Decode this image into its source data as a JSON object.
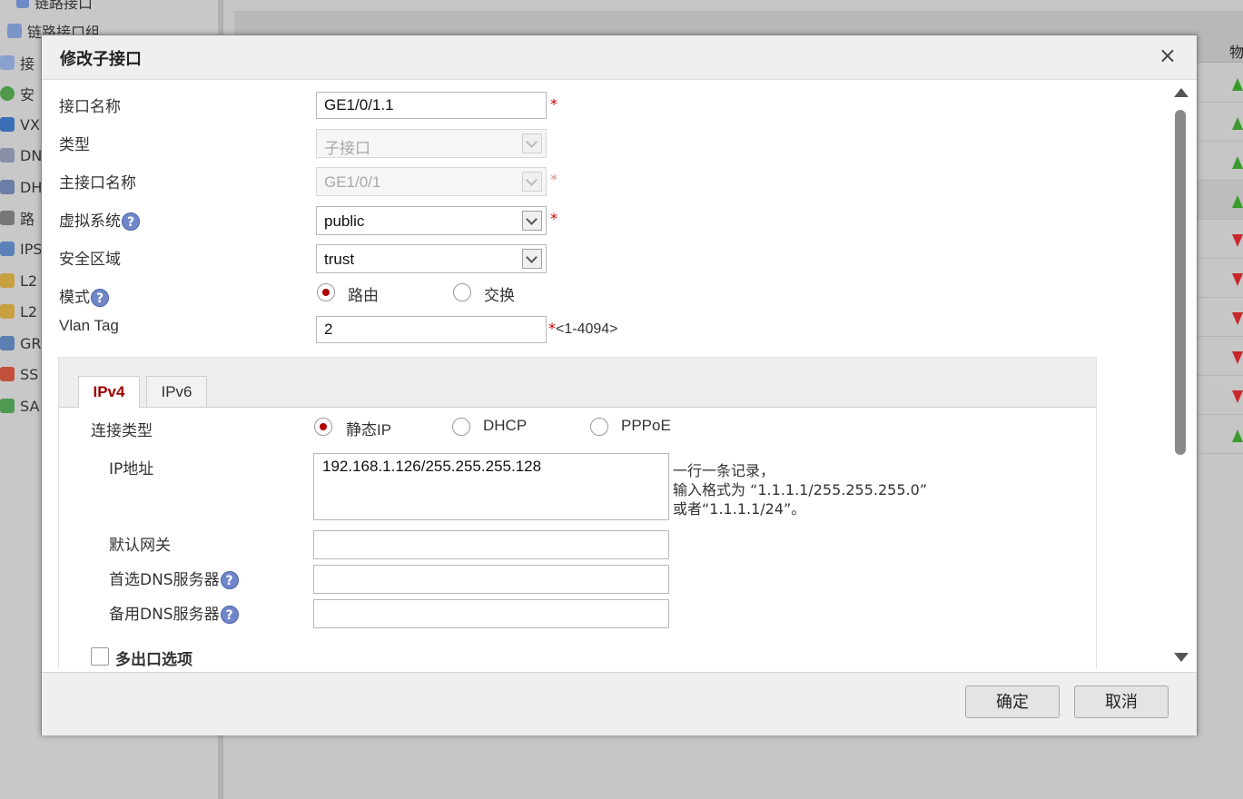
{
  "background": {
    "sidebar_items": [
      "链路接口",
      "链路接口组",
      "接",
      "安",
      "VX",
      "DN",
      "DH",
      "路",
      "IPS",
      "L2",
      "L2",
      "GR",
      "SS",
      "SA"
    ],
    "table_header_first": "物"
  },
  "dialog": {
    "title": "修改子接口",
    "close_icon": "×",
    "fields": {
      "interface_name": {
        "label": "接口名称",
        "value": "GE1/0/1.1"
      },
      "type": {
        "label": "类型",
        "value": "子接口"
      },
      "main_interface": {
        "label": "主接口名称",
        "value": "GE1/0/1"
      },
      "virtual_system": {
        "label": "虚拟系统",
        "value": "public"
      },
      "security_zone": {
        "label": "安全区域",
        "value": "trust"
      },
      "mode": {
        "label": "模式",
        "options": [
          "路由",
          "交换"
        ],
        "selected": "路由"
      },
      "vlan_tag": {
        "label": "Vlan Tag",
        "value": "2",
        "range": "<1-4094>"
      }
    },
    "required_mark": "*",
    "help_icon": "?",
    "tabs": [
      {
        "label": "IPv4",
        "active": true
      },
      {
        "label": "IPv6",
        "active": false
      }
    ],
    "ipv4": {
      "connection_type": {
        "label": "连接类型",
        "options": [
          "静态IP",
          "DHCP",
          "PPPoE"
        ],
        "selected": "静态IP"
      },
      "ip_address": {
        "label": "IP地址",
        "value": "192.168.1.126/255.255.255.128",
        "hint_lines": [
          "一行一条记录，",
          "输入格式为 “1.1.1.1/255.255.255.0”",
          "或者“1.1.1.1/24”。"
        ]
      },
      "default_gateway": {
        "label": "默认网关",
        "value": ""
      },
      "primary_dns": {
        "label": "首选DNS服务器",
        "value": ""
      },
      "secondary_dns": {
        "label": "备用DNS服务器",
        "value": ""
      },
      "multi_exit": {
        "label": "多出口选项",
        "checked": false
      }
    },
    "buttons": {
      "ok": "确定",
      "cancel": "取消"
    }
  },
  "colors": {
    "required": "#d40000",
    "active_tab": "#a00000",
    "radio_dot": "#b00000",
    "help_icon": "#6f86c8",
    "link_up": "#3a9a2c",
    "link_down": "#c8282b"
  }
}
